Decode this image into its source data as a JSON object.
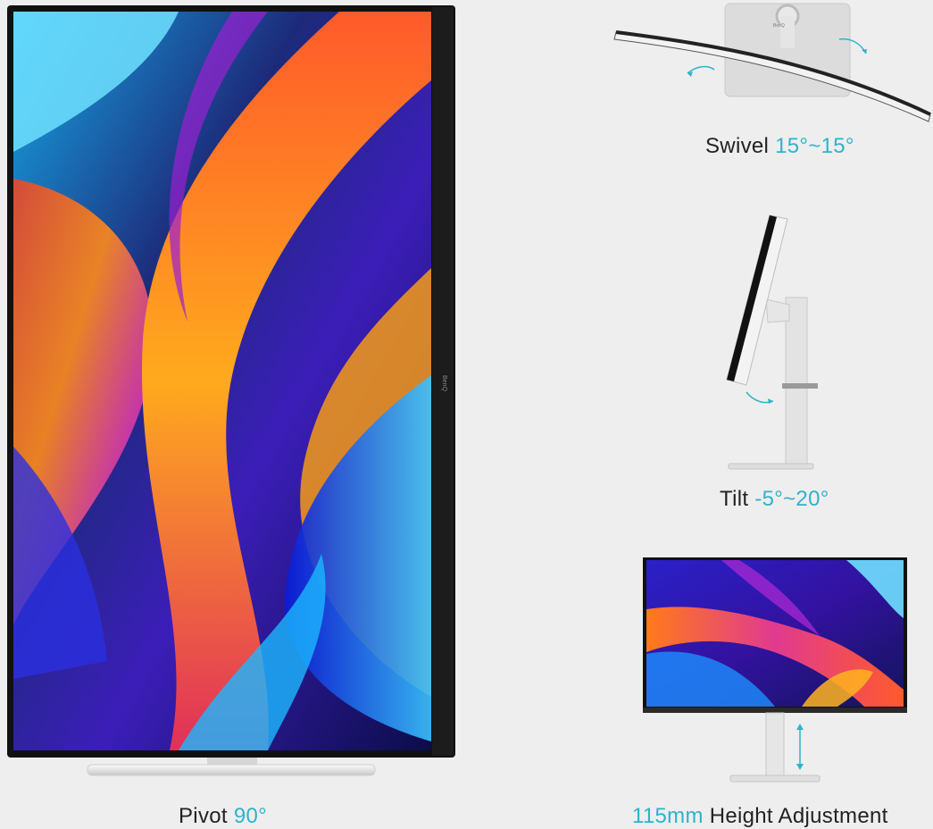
{
  "accent_color": "#2fb3c8",
  "pivot": {
    "label": "Pivot",
    "value": "90°",
    "brand_on_bezel": "BenQ"
  },
  "swivel": {
    "label": "Swivel",
    "value": "15°~15°",
    "brand_on_back": "BenQ"
  },
  "tilt": {
    "label": "Tilt",
    "value": "-5°~20°"
  },
  "height": {
    "value": "115mm",
    "label": "Height Adjustment"
  }
}
